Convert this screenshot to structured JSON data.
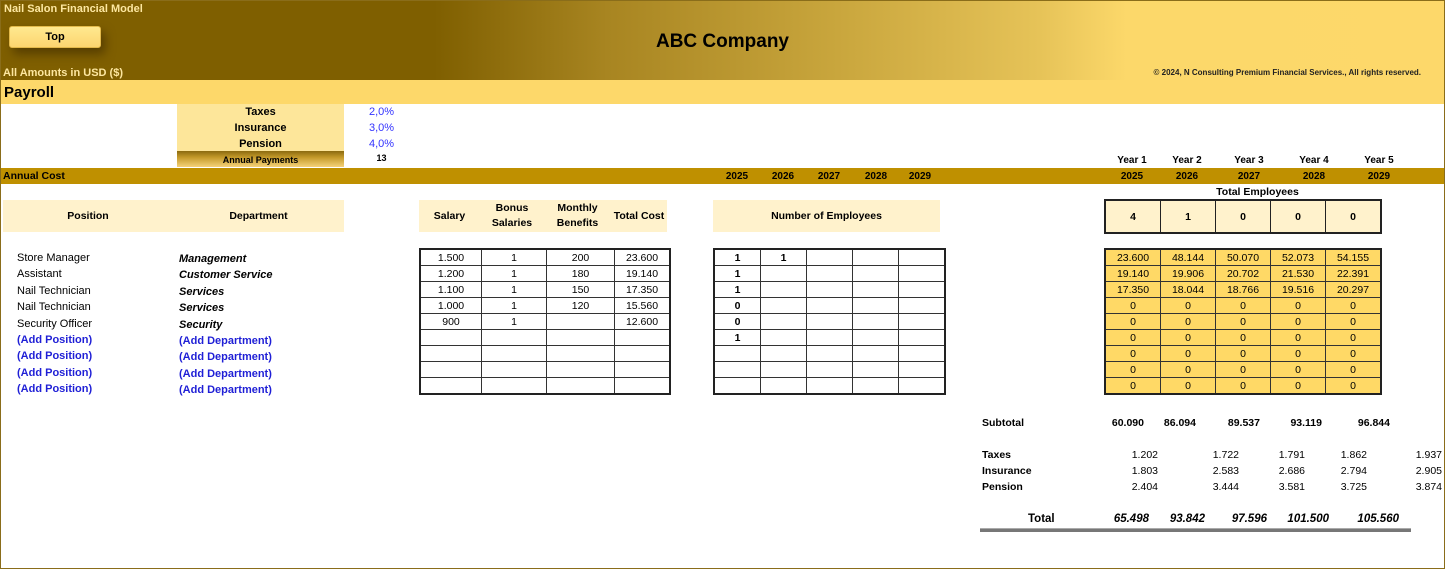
{
  "header": {
    "model_title": "Nail Salon Financial Model",
    "top_button": "Top",
    "company": "ABC Company",
    "amounts_note": "All Amounts in  USD ($)",
    "copyright": "© 2024, N Consulting Premium Financial Services., All rights reserved."
  },
  "section_title": "Payroll",
  "rates": [
    {
      "label": "Taxes",
      "value": "2,0%"
    },
    {
      "label": "Insurance",
      "value": "3,0%"
    },
    {
      "label": "Pension",
      "value": "4,0%"
    }
  ],
  "annual_payments": {
    "label": "Annual Payments",
    "value": "13"
  },
  "annual_cost_label": "Annual Cost",
  "employee_years": [
    "2025",
    "2026",
    "2027",
    "2028",
    "2029"
  ],
  "summary_year_labels": [
    "Year 1",
    "Year 2",
    "Year 3",
    "Year 4",
    "Year 5"
  ],
  "summary_years": [
    "2025",
    "2026",
    "2027",
    "2028",
    "2029"
  ],
  "columns": {
    "position": "Position",
    "department": "Department",
    "salary": "Salary",
    "bonus": "Bonus Salaries",
    "benefits": "Monthly Benefits",
    "total_cost": "Total Cost",
    "num_employees": "Number of Employees",
    "total_employees": "Total Employees"
  },
  "rows": [
    {
      "position": "Store Manager",
      "department": "Management",
      "salary": "1.500",
      "bonus": "1",
      "benefits": "200",
      "total_cost": "23.600",
      "employees": [
        "1",
        "1",
        "",
        "",
        ""
      ],
      "annual": [
        "23.600",
        "48.144",
        "50.070",
        "52.073",
        "54.155"
      ]
    },
    {
      "position": "Assistant",
      "department": "Customer Service",
      "salary": "1.200",
      "bonus": "1",
      "benefits": "180",
      "total_cost": "19.140",
      "employees": [
        "1",
        "",
        "",
        "",
        ""
      ],
      "annual": [
        "19.140",
        "19.906",
        "20.702",
        "21.530",
        "22.391"
      ]
    },
    {
      "position": "Nail Technician",
      "department": "Services",
      "salary": "1.100",
      "bonus": "1",
      "benefits": "150",
      "total_cost": "17.350",
      "employees": [
        "1",
        "",
        "",
        "",
        ""
      ],
      "annual": [
        "17.350",
        "18.044",
        "18.766",
        "19.516",
        "20.297"
      ]
    },
    {
      "position": "Nail Technician",
      "department": "Services",
      "salary": "1.000",
      "bonus": "1",
      "benefits": "120",
      "total_cost": "15.560",
      "employees": [
        "0",
        "",
        "",
        "",
        ""
      ],
      "annual": [
        "0",
        "0",
        "0",
        "0",
        "0"
      ]
    },
    {
      "position": "Security Officer",
      "department": "Security",
      "salary": "900",
      "bonus": "1",
      "benefits": "",
      "total_cost": "12.600",
      "employees": [
        "0",
        "",
        "",
        "",
        ""
      ],
      "annual": [
        "0",
        "0",
        "0",
        "0",
        "0"
      ]
    },
    {
      "position": "(Add Position)",
      "department": "(Add Department)",
      "salary": "",
      "bonus": "",
      "benefits": "",
      "total_cost": "",
      "employees": [
        "1",
        "",
        "",
        "",
        ""
      ],
      "annual": [
        "0",
        "0",
        "0",
        "0",
        "0"
      ],
      "placeholder": true
    },
    {
      "position": "(Add Position)",
      "department": "(Add Department)",
      "salary": "",
      "bonus": "",
      "benefits": "",
      "total_cost": "",
      "employees": [
        "",
        "",
        "",
        "",
        ""
      ],
      "annual": [
        "0",
        "0",
        "0",
        "0",
        "0"
      ],
      "placeholder": true
    },
    {
      "position": "(Add Position)",
      "department": "(Add Department)",
      "salary": "",
      "bonus": "",
      "benefits": "",
      "total_cost": "",
      "employees": [
        "",
        "",
        "",
        "",
        ""
      ],
      "annual": [
        "0",
        "0",
        "0",
        "0",
        "0"
      ],
      "placeholder": true
    },
    {
      "position": "(Add Position)",
      "department": "(Add Department)",
      "salary": "",
      "bonus": "",
      "benefits": "",
      "total_cost": "",
      "employees": [
        "",
        "",
        "",
        "",
        ""
      ],
      "annual": [
        "0",
        "0",
        "0",
        "0",
        "0"
      ],
      "placeholder": true
    }
  ],
  "total_employees": [
    "4",
    "1",
    "0",
    "0",
    "0"
  ],
  "summary": {
    "subtotal": {
      "label": "Subtotal",
      "values": [
        "60.090",
        "86.094",
        "89.537",
        "93.119",
        "96.844"
      ]
    },
    "taxes": {
      "label": "Taxes",
      "values": [
        "1.202",
        "1.722",
        "1.791",
        "1.862",
        "1.937"
      ]
    },
    "insurance": {
      "label": "Insurance",
      "values": [
        "1.803",
        "2.583",
        "2.686",
        "2.794",
        "2.905"
      ]
    },
    "pension": {
      "label": "Pension",
      "values": [
        "2.404",
        "3.444",
        "3.581",
        "3.725",
        "3.874"
      ]
    },
    "total": {
      "label": "Total",
      "values": [
        "65.498",
        "93.842",
        "97.596",
        "101.500",
        "105.560"
      ]
    }
  }
}
